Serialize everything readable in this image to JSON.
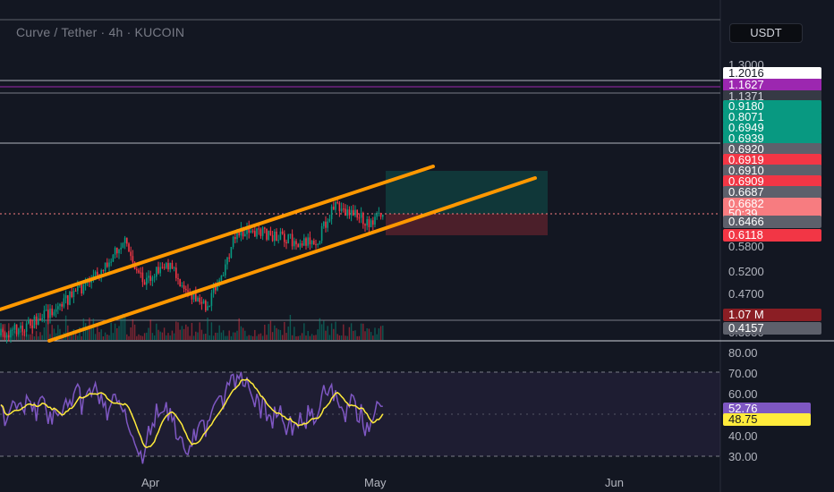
{
  "header": {
    "title": "Curve / Tether · 4h · KUCOIN",
    "currency": "USDT"
  },
  "price_axis": {
    "ticks": [
      "1.3000",
      "0.5800",
      "0.5200",
      "0.4700",
      "0.3950"
    ]
  },
  "price_tags": [
    {
      "text": "1.2016",
      "bg": "#ffffff",
      "fg": "#131722"
    },
    {
      "text": "1.1627",
      "bg": "#9c27b0",
      "fg": "#ffffff"
    },
    {
      "text": "1.1371",
      "bg": "#363a45",
      "fg": "#d1d4dc"
    },
    {
      "text": "0.9180",
      "bg": "#089981",
      "fg": "#ffffff"
    },
    {
      "text": "0.8071",
      "bg": "#089981",
      "fg": "#ffffff"
    },
    {
      "text": "0.6949",
      "bg": "#089981",
      "fg": "#ffffff"
    },
    {
      "text": "0.6939",
      "bg": "#089981",
      "fg": "#ffffff"
    },
    {
      "text": "0.6920",
      "bg": "#5d606b",
      "fg": "#ffffff"
    },
    {
      "text": "0.6919",
      "bg": "#f23645",
      "fg": "#ffffff"
    },
    {
      "text": "0.6910",
      "bg": "#5d606b",
      "fg": "#ffffff"
    },
    {
      "text": "0.6909",
      "bg": "#f23645",
      "fg": "#ffffff"
    },
    {
      "text": "0.6687",
      "bg": "#5d606b",
      "fg": "#ffffff"
    },
    {
      "text": "0.6682",
      "bg": "#f77c80",
      "fg": "#ffffff"
    },
    {
      "text": "50:39",
      "bg": "#f77c80",
      "fg": "#ffffff"
    },
    {
      "text": "0.6466",
      "bg": "#5d606b",
      "fg": "#ffffff"
    },
    {
      "text": "0.6118",
      "bg": "#f23645",
      "fg": "#ffffff"
    },
    {
      "text": "1.07 M",
      "bg": "#8b1e24",
      "fg": "#ffffff"
    },
    {
      "text": "0.4157",
      "bg": "#5d606b",
      "fg": "#ffffff"
    }
  ],
  "rsi": {
    "ticks": [
      "80.00",
      "70.00",
      "60.00",
      "40.00",
      "30.00"
    ],
    "tag_rsi": "52.76",
    "tag_ma": "48.75",
    "rsi_color": "#7e57c2",
    "ma_color": "#ffeb3b"
  },
  "time_axis": {
    "labels": [
      "Apr",
      "May",
      "Jun"
    ]
  },
  "colors": {
    "background": "#131722",
    "up": "#089981",
    "down": "#f23645",
    "channel": "#ff9800"
  },
  "chart_data": {
    "type": "candlestick",
    "symbol": "CRV/USDT",
    "interval": "4h",
    "exchange": "KUCOIN",
    "ylim": [
      0.38,
      1.32
    ],
    "last_price": 0.6682,
    "countdown": "50:39",
    "drawn_lines": [
      {
        "label": "1.2016"
      },
      {
        "label": "1.1627"
      },
      {
        "label": "1.1371"
      },
      {
        "label": "0.9180"
      }
    ],
    "channel": {
      "upper": "ascending",
      "lower": "ascending",
      "color": "orange"
    },
    "position_tool": {
      "entry": 0.6466,
      "target": 0.6687,
      "stop": 0.6118
    },
    "rsi": {
      "last": 52.76,
      "ma": 48.75,
      "levels": [
        70,
        30
      ]
    }
  }
}
